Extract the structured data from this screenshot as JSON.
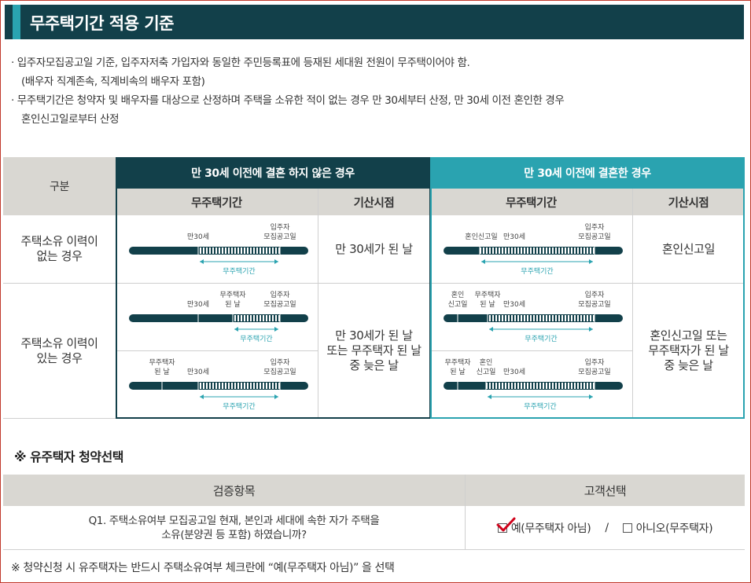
{
  "header": {
    "title": "무주택기간 적용 기준"
  },
  "notes": [
    "· 입주자모집공고일 기준, 입주자저축 가입자와 동일한 주민등록표에 등재된 세대원 전원이 무주택이어야 함.",
    "(배우자 직계존속, 직계비속의 배우자 포함)",
    "· 무주택기간은 청약자 및 배우자를 대상으로 산정하며 주택을 소유한 적이 없는 경우 만 30세부터 산정, 만 30세 이전 혼인한 경우",
    "혼인신고일로부터 산정"
  ],
  "table1": {
    "col_category": "구분",
    "group_unmarried": "만 30세 이전에 결혼 하지 않은 경우",
    "group_married": "만 30세 이전에 결혼한 경우",
    "sub_period": "무주택기간",
    "sub_start": "기산시점",
    "row_never": "주택소유 이력이 없는 경우",
    "row_never_l1": "주택소유 이력이",
    "row_never_l2": "없는 경우",
    "row_had_l1": "주택소유 이력이",
    "row_had_l2": "있는 경우",
    "start_never_unmarried": "만 30세가 된 날",
    "start_never_married": "혼인신고일",
    "start_had_unmarried_l1": "만 30세가 된 날",
    "start_had_unmarried_l2": "또는 무주택자 된 날",
    "start_had_unmarried_l3": "중 늦은 날",
    "start_had_married_l1": "혼인신고일 또는",
    "start_had_married_l2": "무주택자가 된 날",
    "start_had_married_l3": "중 늦은 날",
    "lbl_age30": "만30세",
    "lbl_notice1": "입주자",
    "lbl_notice2": "모집공고일",
    "lbl_period": "무주택기간",
    "lbl_hn1": "무주택자",
    "lbl_hn2": "된 날",
    "lbl_mar1": "혼인",
    "lbl_mar2": "신고일",
    "lbl_marriage_full": "혼인신고일"
  },
  "section2": {
    "title": "※ 유주택자 청약선택"
  },
  "table2": {
    "col_item": "검증항목",
    "col_choice": "고객선택",
    "q1_l1": "Q1. 주택소유여부 모집공고일 현재, 본인과 세대에 속한 자가 주택을",
    "q1_l2": "소유(분양권 등 포함) 하였습니까?",
    "opt_yes": "예(무주택자 아님)",
    "sep": "/",
    "opt_no": "아니오(무주택자)"
  },
  "footer": "※ 청약신청 시 유주택자는 반드시 주택소유여부 체크란에 “예(무주택자 아님)” 을 선택",
  "colors": {
    "dark": "#12404a",
    "teal": "#2aa3b0",
    "gray": "#d9d7d2",
    "check": "#d0021b"
  }
}
